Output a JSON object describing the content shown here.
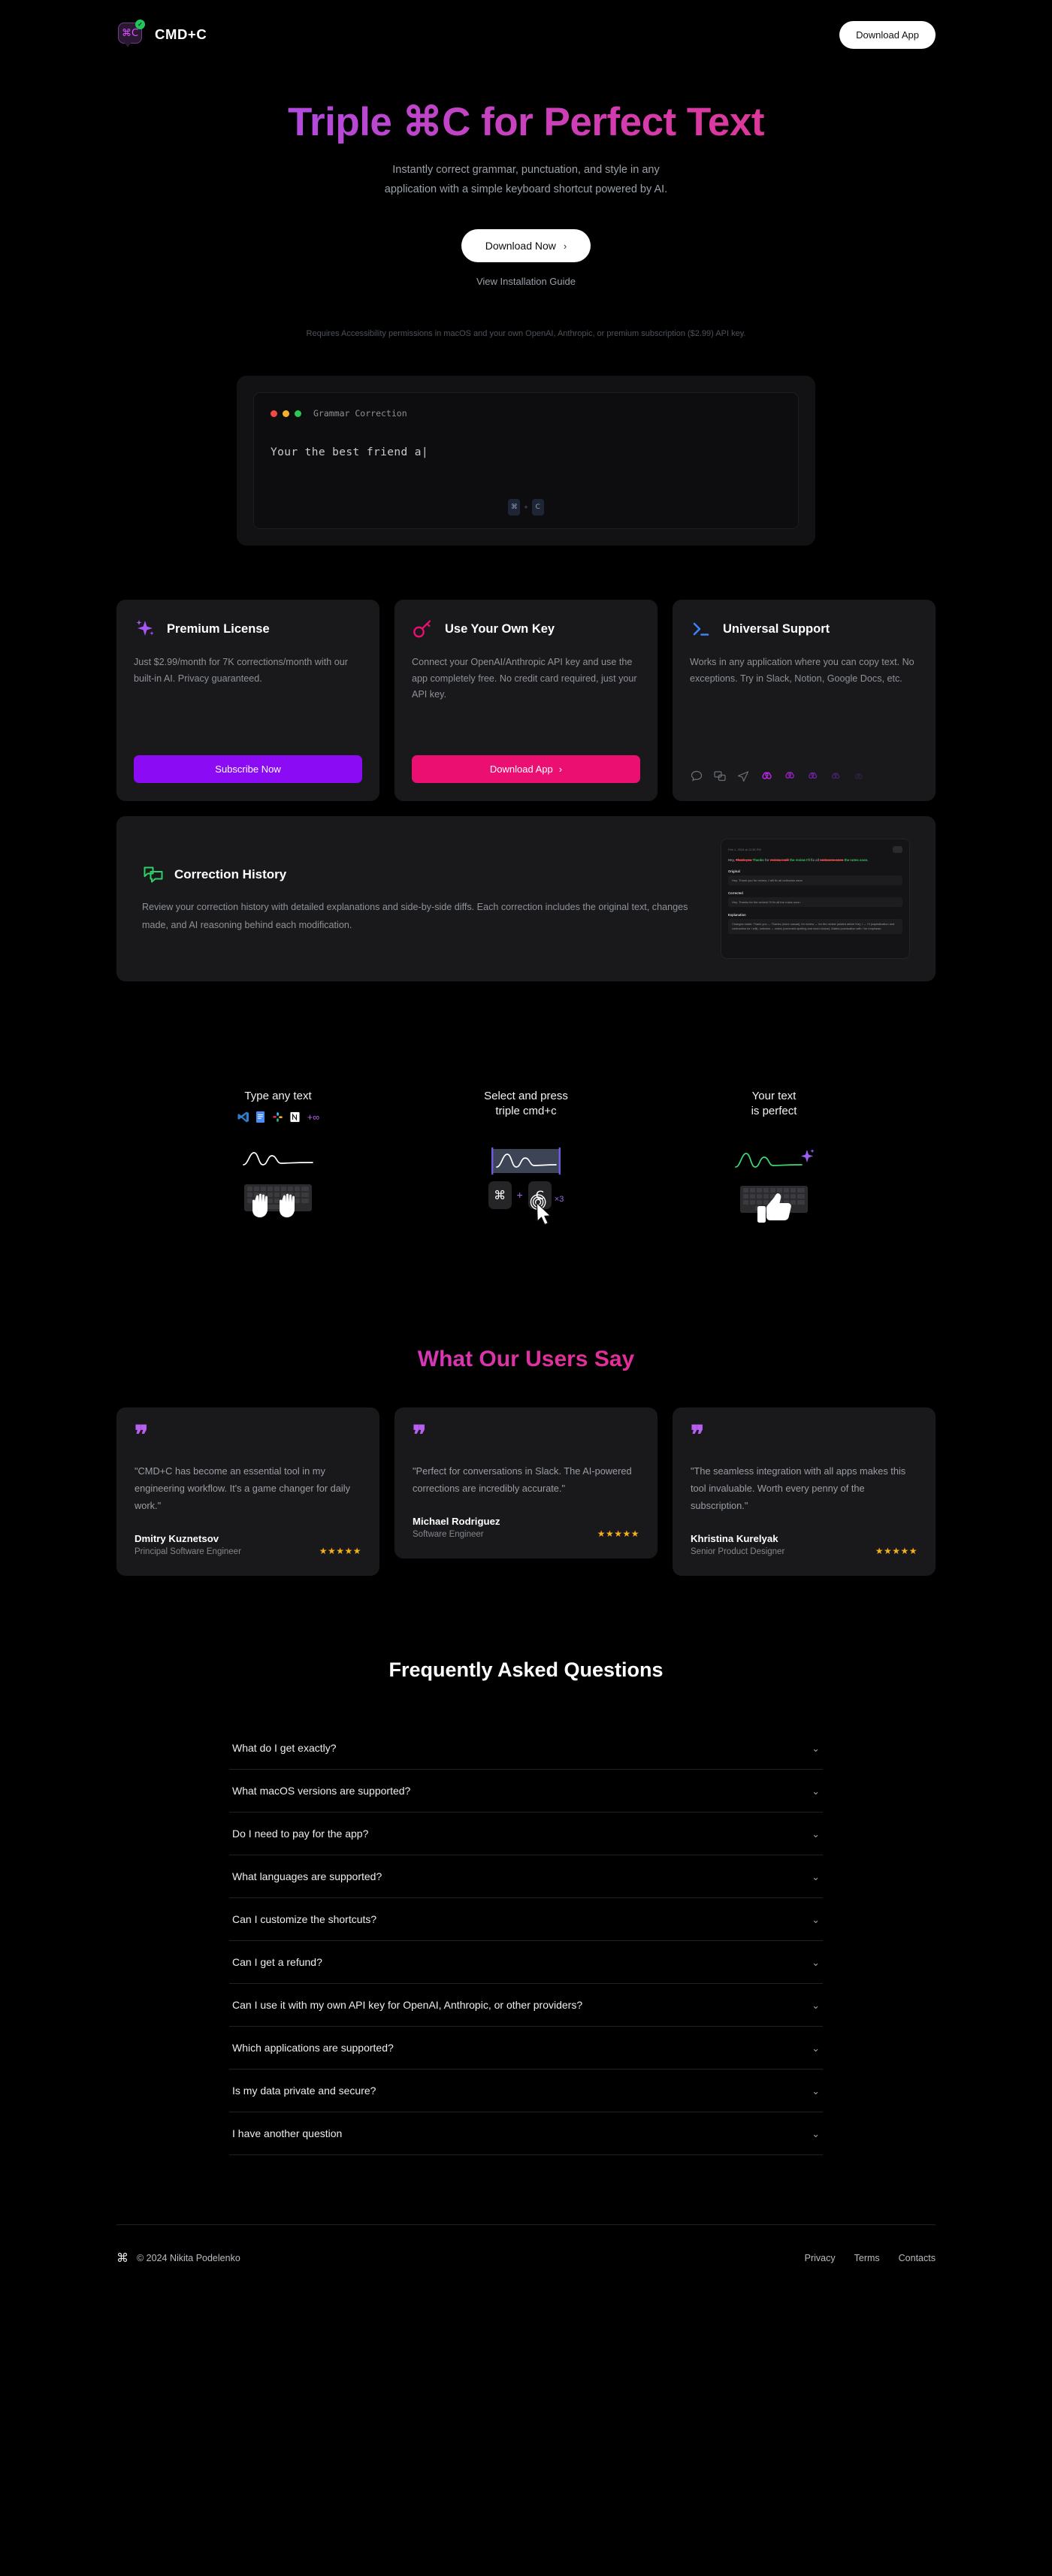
{
  "header": {
    "brand_name": "CMD+C",
    "brand_glyph": "⌘C",
    "download_label": "Download App"
  },
  "hero": {
    "title": "Triple ⌘C for Perfect Text",
    "subtitle_line1": "Instantly correct grammar, punctuation, and style in any",
    "subtitle_line2": "application with a simple keyboard shortcut powered by AI.",
    "cta_label": "Download Now",
    "cta_chevron": "›",
    "secondary_link": "View Installation Guide",
    "note": "Requires Accessibility permissions in macOS and your own OpenAI, Anthropic, or premium subscription ($2.99) API key."
  },
  "demo": {
    "window_title": "Grammar Correction",
    "text": "Your the best friend a",
    "caret": "|",
    "key_cmd": "⌘",
    "key_plus": "+",
    "key_c": "C"
  },
  "features": [
    {
      "icon": "sparkle-icon",
      "title": "Premium License",
      "desc": "Just $2.99/month for 7K corrections/month with our built-in AI. Privacy guaranteed.",
      "button": "Subscribe Now",
      "button_chevron": "",
      "button_color": "#8b0bf5"
    },
    {
      "icon": "key-icon",
      "title": "Use Your Own Key",
      "desc": "Connect your OpenAI/Anthropic API key and use the app completely free. No credit card required, just your API key.",
      "button": "Download App",
      "button_chevron": "›",
      "button_color": "#ec0f72"
    },
    {
      "icon": "terminal-prompt-icon",
      "title": "Universal Support",
      "desc": "Works in any application where you can copy text. No exceptions. Try in Slack, Notion, Google Docs, etc.",
      "button": "",
      "button_chevron": "",
      "button_color": ""
    }
  ],
  "history": {
    "icon": "chat-bubbles-icon",
    "title": "Correction History",
    "desc": "Review your correction history with detailed explanations and side-by-side diffs. Each correction includes the original text, changes made, and AI reasoning behind each modification.",
    "screenshot": {
      "date": "Feb 1, 2024 at 11:36 PM",
      "diff_prefix": "Hey, ",
      "diff_del1": "Thank you",
      "diff_ins1": "Thanks",
      "diff_mid1": " for ",
      "diff_del2": "review, i will",
      "diff_ins2": "the review I'll",
      "diff_mid2": " fix all ",
      "diff_del3": "notioсеѕѕ asоn",
      "diff_ins3": "the notes soon.",
      "label_original": "Original",
      "original_text": "Hey. Thank you for review, I will fix all notiосеss asоn",
      "label_corrected": "Corrected",
      "corrected_text": "Hey. Thanks for the review! I'll fix all the notes soon.",
      "label_explanation": "Explanation",
      "explanation_text": "Changes made: Thank you → Thanks (more casual), for review → for the review (added article the), i → I'll (capitalization and contraction for I will), notiсess → notes (corrected spelling and word choice). Added punctuation with ! for emphasis."
    }
  },
  "steps": [
    {
      "title_line1": "Type any text",
      "title_line2": "",
      "apps": [
        "vscode-icon",
        "google-docs-icon",
        "slack-icon",
        "notion-icon"
      ],
      "plus_infinity": "+∞"
    },
    {
      "title_line1": "Select and press",
      "title_line2": "triple cmd+c",
      "key_cmd": "⌘",
      "key_plus": "+",
      "key_c": "C",
      "repeat_label": "×3"
    },
    {
      "title_line1": "Your text",
      "title_line2": "is perfect"
    }
  ],
  "testimonials": {
    "title": "What Our Users Say",
    "quote_glyph": "❞",
    "items": [
      {
        "quote": "\"CMD+C has become an essential tool in my engineering workflow. It's a game changer for daily work.\"",
        "name": "Dmitry Kuznetsov",
        "role": "Principal Software Engineer",
        "stars": "★★★★★"
      },
      {
        "quote": "\"Perfect for conversations in Slack. The AI-powered corrections are incredibly accurate.\"",
        "name": "Michael Rodriguez",
        "role": "Software Engineer",
        "stars": "★★★★★"
      },
      {
        "quote": "\"The seamless integration with all apps makes this tool invaluable. Worth every penny of the subscription.\"",
        "name": "Khristina Kurelyak",
        "role": "Senior Product Designer",
        "stars": "★★★★★"
      }
    ]
  },
  "faq": {
    "title": "Frequently Asked Questions",
    "chevron": "⌄",
    "items": [
      "What do I get exactly?",
      "What macOS versions are supported?",
      "Do I need to pay for the app?",
      "What languages are supported?",
      "Can I customize the shortcuts?",
      "Can I get a refund?",
      "Can I use it with my own API key for OpenAI, Anthropic, or other providers?",
      "Which applications are supported?",
      "Is my data private and secure?",
      "I have another question"
    ]
  },
  "footer": {
    "cmd_glyph": "⌘",
    "copyright": "© 2024 Nikita Podelenko",
    "links": [
      "Privacy",
      "Terms",
      "Contacts"
    ]
  },
  "colors": {
    "background": "#000000",
    "card": "#19191c",
    "accent_purple": "#8b0bf5",
    "accent_pink": "#ec0f72",
    "muted_text": "#8d9298",
    "star": "#f5b01a"
  }
}
